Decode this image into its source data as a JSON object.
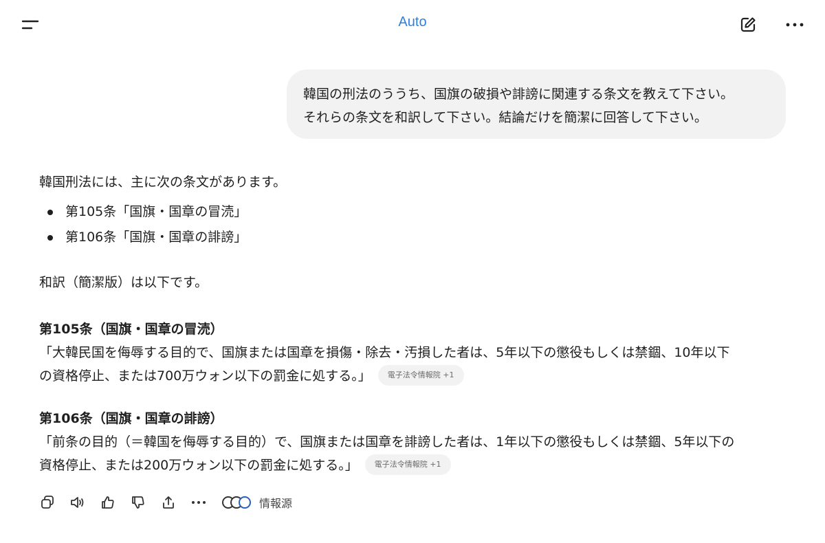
{
  "header": {
    "title": "Auto",
    "menu_icon": "sidebar-menu-icon",
    "new_chat_icon": "edit-icon",
    "more_icon": "more-horizontal-icon",
    "accent_color": "#2f7fe0"
  },
  "user_message": {
    "lines": [
      "韓国の刑法のううち、国旗の破損や誹謗に関連する条文を教えて下さい。",
      "それらの条文を和訳して下さい。結論だけを簡潔に回答して下さい。"
    ]
  },
  "assistant": {
    "intro": "韓国刑法には、主に次の条文があります。",
    "bullets": [
      "第105条「国旗・国章の冒涜」",
      "第106条「国旗・国章の誹謗」"
    ],
    "translation_intro": "和訳（簡潔版）は以下です。",
    "articles": [
      {
        "heading": "第105条（国旗・国章の冒涜）",
        "lines": [
          "「大韓民国を侮辱する目的で、国旗または国章を損傷・除去・汚損した者は、5年以下の懲役もしくは禁錮、10年以下",
          "の資格停止、または700万ウォン以下の罰金に処する。」"
        ],
        "source": "電子法令情報院 +1"
      },
      {
        "heading": "第106条（国旗・国章の誹謗）",
        "lines": [
          "「前条の目的（＝韓国を侮辱する目的）で、国旗または国章を誹謗した者は、1年以下の懲役もしくは禁錮、5年以下の",
          "資格停止、または200万ウォン以下の罰金に処する。」"
        ],
        "source": "電子法令情報院 +1"
      }
    ]
  },
  "actions": {
    "icons": [
      "copy-icon",
      "read-aloud-icon",
      "thumbs-up-icon",
      "thumbs-down-icon",
      "share-icon",
      "more-icon"
    ],
    "sources_label": "情報源"
  }
}
